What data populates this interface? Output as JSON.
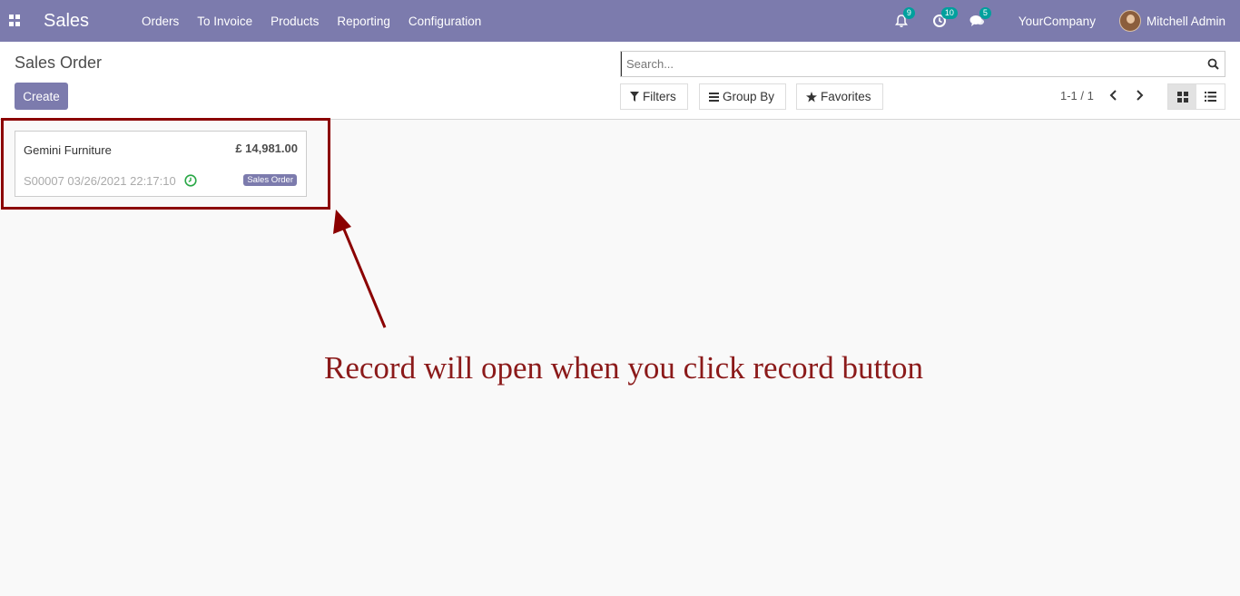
{
  "app": {
    "brand": "Sales",
    "menu": [
      "Orders",
      "To Invoice",
      "Products",
      "Reporting",
      "Configuration"
    ]
  },
  "systray": {
    "notifications_count": "9",
    "activities_count": "10",
    "messages_count": "5",
    "company": "YourCompany",
    "user": "Mitchell Admin"
  },
  "control_panel": {
    "breadcrumb": "Sales Order",
    "create_label": "Create",
    "search_placeholder": "Search...",
    "filters_label": "Filters",
    "groupby_label": "Group By",
    "favorites_label": "Favorites",
    "pager": "1-1 / 1"
  },
  "record": {
    "customer": "Gemini Furniture",
    "amount": "£ 14,981.00",
    "reference": "S00007 03/26/2021 22:17:10",
    "status": "Sales Order"
  },
  "annotation": {
    "caption": "Record will open when you click record button"
  },
  "colors": {
    "brand": "#7c7bad",
    "badge": "#00a09d",
    "annotation": "#8b0000"
  }
}
